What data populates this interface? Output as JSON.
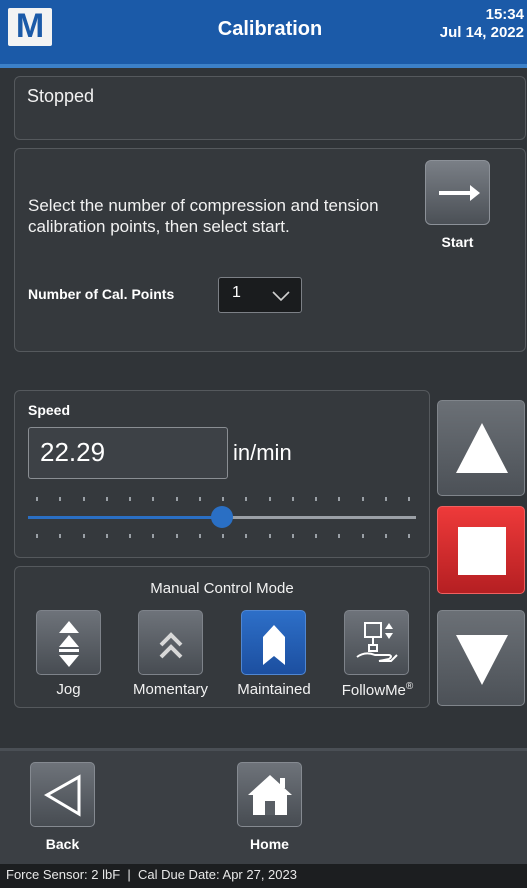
{
  "header": {
    "logo_letter": "M",
    "title": "Calibration",
    "time": "15:34",
    "date": "Jul 14, 2022"
  },
  "status": {
    "text": "Stopped"
  },
  "setup": {
    "instructions": "Select the number of compression and tension calibration points, then select start.",
    "start_label": "Start",
    "calpoints_label": "Number of Cal. Points",
    "calpoints_value": "1"
  },
  "speed": {
    "label": "Speed",
    "value": "22.29",
    "unit": "in/min",
    "slider_fraction": 0.5
  },
  "manual_mode": {
    "title": "Manual Control Mode",
    "modes": [
      {
        "label": "Jog",
        "active": false,
        "icon": "jog-icon"
      },
      {
        "label": "Momentary",
        "active": false,
        "icon": "momentary-icon"
      },
      {
        "label": "Maintained",
        "active": true,
        "icon": "maintained-icon"
      },
      {
        "label": "FollowMe",
        "sup": "®",
        "active": false,
        "icon": "followme-icon"
      }
    ]
  },
  "jog": {
    "up_icon": "arrow-up-icon",
    "stop_icon": "stop-icon",
    "down_icon": "arrow-down-icon"
  },
  "nav": {
    "back_label": "Back",
    "home_label": "Home"
  },
  "footer": {
    "text": "Force Sensor: 2 lbF  |  Cal Due Date: Apr 27, 2023"
  },
  "colors": {
    "header": "#1b5aa8",
    "background": "#303438",
    "active_mode": "#1c4fa0",
    "stop_button": "#d42a2d",
    "slider": "#2a6fc4"
  }
}
